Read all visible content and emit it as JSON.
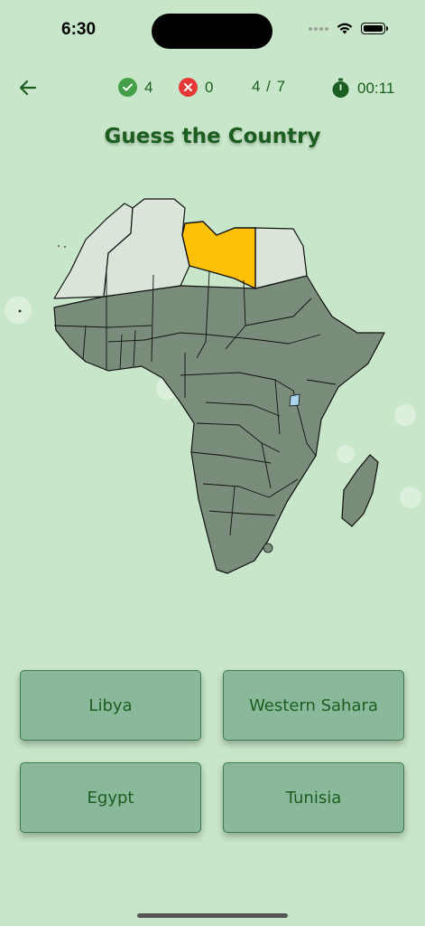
{
  "status": {
    "time": "6:30"
  },
  "stats": {
    "correct_count": "4",
    "wrong_count": "0",
    "progress": "4 / 7",
    "timer": "00:11"
  },
  "title": "Guess the Country",
  "answers": [
    "Libya",
    "Western Sahara",
    "Egypt",
    "Tunisia"
  ],
  "colors": {
    "background": "#c8e6c9",
    "highlight_country": "#ffc107",
    "other_countries": "#7a8c7a",
    "answered_countries": "#d8e5d8",
    "correct": "#43a047",
    "wrong": "#e53935",
    "text": "#1b5e20",
    "button": "#8ab89b"
  },
  "icons": {
    "back": "arrow-left-icon",
    "correct": "check-circle-icon",
    "wrong": "x-circle-icon",
    "timer": "stopwatch-icon"
  }
}
